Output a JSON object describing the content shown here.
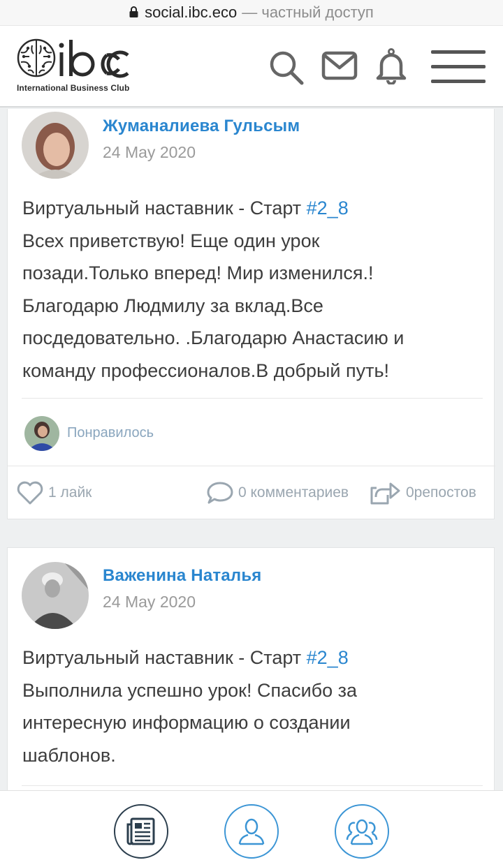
{
  "browser": {
    "domain": "social.ibc.eco",
    "suffix": "— частный доступ"
  },
  "header": {
    "logo_tagline": "International Business Club",
    "icons": [
      "search-icon",
      "mail-icon",
      "bell-icon",
      "menu-icon"
    ]
  },
  "posts": [
    {
      "author": "Жуманалиева Гульсым",
      "date": "24 May 2020",
      "title_prefix": "Виртуальный наставник - Старт ",
      "hashtag": "#2_8",
      "lines": [
        "Всех приветствую! Еще один урок",
        "позади.Только вперед! Мир изменился.!",
        "Благодарю Людмилу за вклад.Все",
        "поcдедовательно. .Благодарю Анастасию и",
        "команду профессионалов.В добрый путь!"
      ],
      "liked_label": "Понравилось",
      "likes": "1 лайк",
      "comments": "0 комментариев",
      "reposts": "0репостов"
    },
    {
      "author": "Важенина Наталья",
      "date": "24 May 2020",
      "title_prefix": "Виртуальный наставник - Старт ",
      "hashtag": "#2_8",
      "lines": [
        "Выполнила успешно урок! Спасибо за",
        "интересную информацию о создании",
        "шаблонов."
      ]
    }
  ],
  "bottom_nav": {
    "items": [
      "feed-icon",
      "profile-icon",
      "groups-icon"
    ]
  },
  "colors": {
    "accent": "#2a86cf",
    "nav_active": "#2b3e4d",
    "nav_inactive": "#3b95d5",
    "muted": "#9aa6b0"
  }
}
